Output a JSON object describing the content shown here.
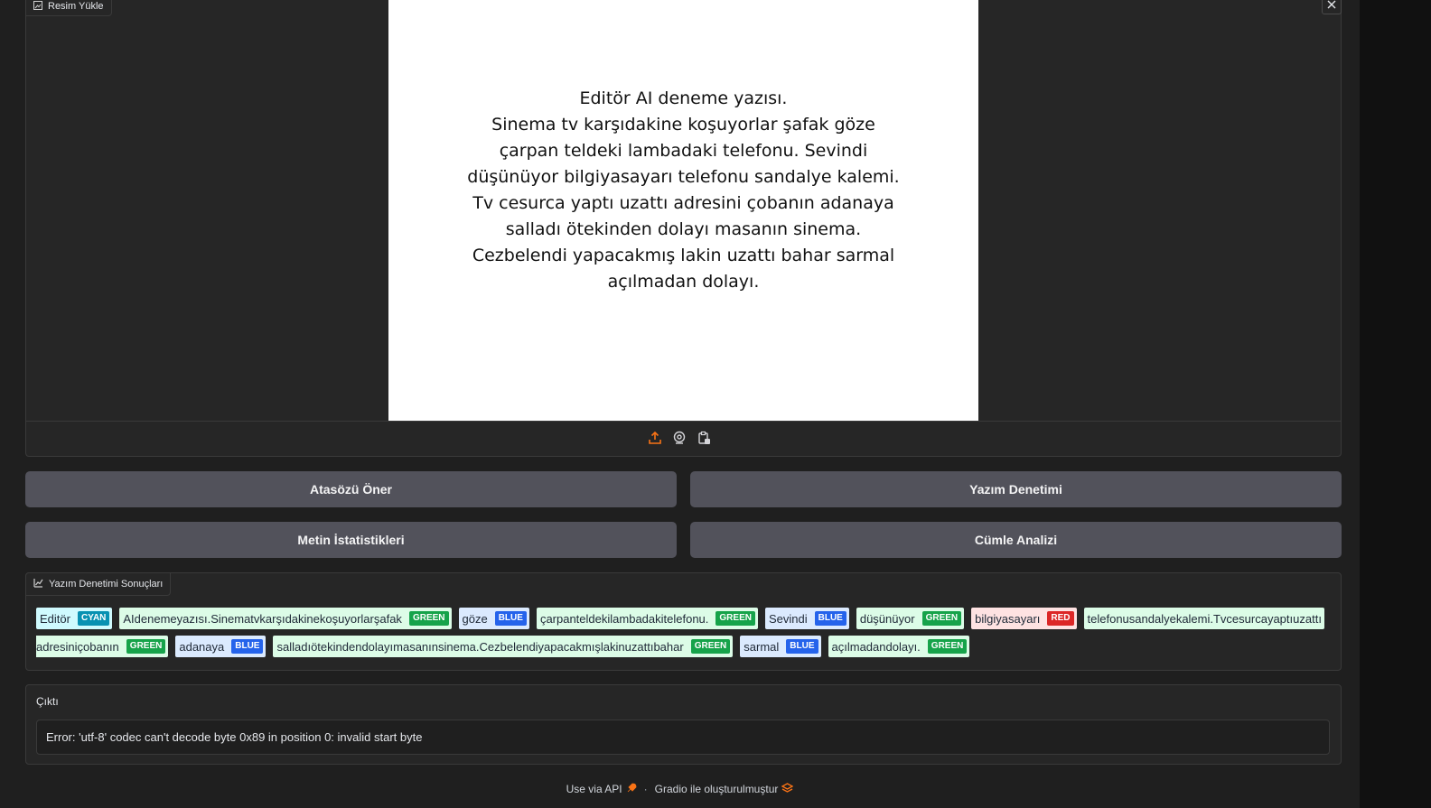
{
  "image_upload": {
    "label": "Resim Yükle",
    "preview_text": "Editör AI deneme yazısı.\nSinema tv karşıdakine koşuyorlar şafak göze\nçarpan teldeki lambadaki telefonu. Sevindi\ndüşünüyor bilgiyasayarı telefonu sandalye kalemi.\nTv cesurca yaptı uzattı adresini çobanın adanaya\nsalladı ötekinden dolayı masanın sinema.\nCezbelendi yapacakmış lakin uzattı bahar sarmal\naçılmadan dolayı.",
    "sources": [
      "upload-icon",
      "webcam-icon",
      "clipboard-icon"
    ],
    "accent_color": "#f97316"
  },
  "buttons": {
    "proverb": "Atasözü Öner",
    "spellcheck": "Yazım Denetimi",
    "stats": "Metin İstatistikleri",
    "sentence": "Cümle Analizi"
  },
  "highlight": {
    "label": "Yazım Denetimi Sonuçları",
    "row1": [
      {
        "text": "Editör",
        "tag": "CYAN",
        "bg": "#cffafe",
        "tagbg": "#0891b2"
      },
      {
        "text": "AIdenemeyazısı.Sinematvkarşıdakinekoşuyorlarşafak",
        "tag": "GREEN",
        "bg": "#dcfce7",
        "tagbg": "#16a34a"
      },
      {
        "text": "göze",
        "tag": "BLUE",
        "bg": "#dbeafe",
        "tagbg": "#2563eb"
      },
      {
        "text": "çarpanteldekilambadakitelefonu.",
        "tag": "GREEN",
        "bg": "#dcfce7",
        "tagbg": "#16a34a"
      },
      {
        "text": "Sevindi",
        "tag": "BLUE",
        "bg": "#dbeafe",
        "tagbg": "#2563eb"
      },
      {
        "text": "düşünüyor",
        "tag": "GREEN",
        "bg": "#dcfce7",
        "tagbg": "#16a34a"
      },
      {
        "text": "bilgiyasayarı",
        "tag": "RED",
        "bg": "#fee2e2",
        "tagbg": "#dc2626"
      },
      {
        "text": "telefonusandalyekalemi.Tvcesurcayaptıuzattı",
        "tag": "",
        "bg": "#dcfce7",
        "tagbg": "#16a34a"
      }
    ],
    "row2": [
      {
        "text": "adresiniçobanın",
        "tag": "GREEN",
        "bg": "#dcfce7",
        "tagbg": "#16a34a"
      },
      {
        "text": "adanaya",
        "tag": "BLUE",
        "bg": "#dbeafe",
        "tagbg": "#2563eb"
      },
      {
        "text": "salladıötekindendolayımasanınsinema.Cezbelendiyapacakmışlakinuzattıbahar",
        "tag": "GREEN",
        "bg": "#dcfce7",
        "tagbg": "#16a34a"
      },
      {
        "text": "sarmal",
        "tag": "BLUE",
        "bg": "#dbeafe",
        "tagbg": "#2563eb"
      },
      {
        "text": "açılmadandolayı.",
        "tag": "GREEN",
        "bg": "#dcfce7",
        "tagbg": "#16a34a"
      }
    ]
  },
  "output": {
    "label": "Çıktı",
    "value": "Error: 'utf-8' codec can't decode byte 0x89 in position 0: invalid start byte"
  },
  "footer": {
    "api": "Use via API",
    "separator": "·",
    "built_with": "Gradio ile oluşturulmuştur"
  }
}
